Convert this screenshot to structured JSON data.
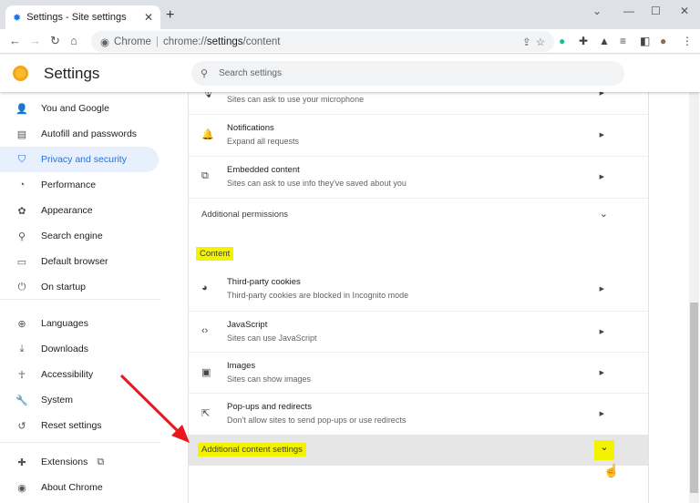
{
  "browser": {
    "tab_title": "Settings - Site settings",
    "omnibox_origin": "Chrome",
    "url_prefix": "chrome://",
    "url_host": "settings",
    "url_path": "/content"
  },
  "header": {
    "title": "Settings",
    "search_placeholder": "Search settings"
  },
  "sidebar": {
    "items": [
      {
        "label": "You and Google",
        "icon": "person-icon"
      },
      {
        "label": "Autofill and passwords",
        "icon": "clipboard-icon"
      },
      {
        "label": "Privacy and security",
        "icon": "shield-icon",
        "active": true
      },
      {
        "label": "Performance",
        "icon": "speedometer-icon"
      },
      {
        "label": "Appearance",
        "icon": "palette-icon"
      },
      {
        "label": "Search engine",
        "icon": "search-icon"
      },
      {
        "label": "Default browser",
        "icon": "browser-icon"
      },
      {
        "label": "On startup",
        "icon": "power-icon"
      },
      {
        "label": "Languages",
        "icon": "globe-icon"
      },
      {
        "label": "Downloads",
        "icon": "download-icon"
      },
      {
        "label": "Accessibility",
        "icon": "accessibility-icon"
      },
      {
        "label": "System",
        "icon": "wrench-icon"
      },
      {
        "label": "Reset settings",
        "icon": "history-icon"
      },
      {
        "label": "Extensions",
        "icon": "puzzle-icon"
      },
      {
        "label": "About Chrome",
        "icon": "chrome-icon"
      }
    ]
  },
  "main": {
    "permissions": [
      {
        "title": "",
        "subtitle": "Sites can ask to use your microphone",
        "icon": "microphone-icon"
      },
      {
        "title": "Notifications",
        "subtitle": "Expand all requests",
        "icon": "bell-icon"
      },
      {
        "title": "Embedded content",
        "subtitle": "Sites can ask to use info they've saved about you",
        "icon": "embedded-icon"
      }
    ],
    "additional_permissions": "Additional permissions",
    "content_heading": "Content",
    "content": [
      {
        "title": "Third-party cookies",
        "subtitle": "Third-party cookies are blocked in Incognito mode",
        "icon": "cookie-icon"
      },
      {
        "title": "JavaScript",
        "subtitle": "Sites can use JavaScript",
        "icon": "code-icon"
      },
      {
        "title": "Images",
        "subtitle": "Sites can show images",
        "icon": "image-icon"
      },
      {
        "title": "Pop-ups and redirects",
        "subtitle": "Don't allow sites to send pop-ups or use redirects",
        "icon": "popup-icon"
      }
    ],
    "additional_content": "Additional content settings"
  },
  "colors": {
    "highlight": "#f3f300",
    "accent": "#1a73e8",
    "annotation_arrow": "#e8191c"
  }
}
